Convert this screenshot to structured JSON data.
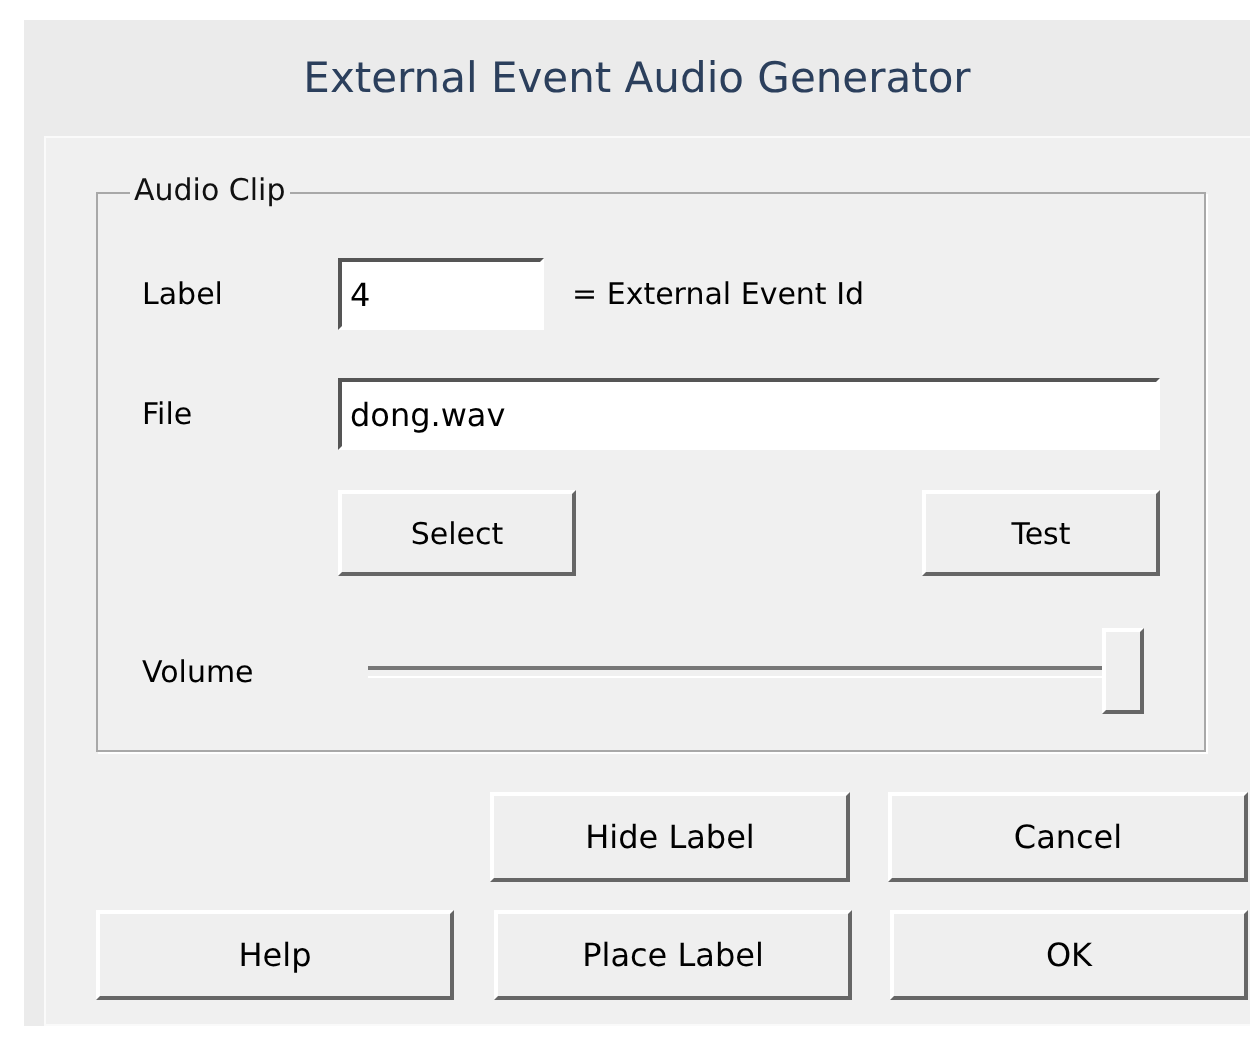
{
  "window": {
    "title": "External Event Audio Generator"
  },
  "group": {
    "title": "Audio Clip"
  },
  "label_field": {
    "label": "Label",
    "value": "4",
    "note": "= External Event Id"
  },
  "file_field": {
    "label": "File",
    "value": "dong.wav"
  },
  "clip_buttons": [
    "Select",
    "Test"
  ],
  "volume": {
    "label": "Volume",
    "level": 1.0
  },
  "button_rows": [
    [
      "Hide Label",
      "Cancel"
    ],
    [
      "Help",
      "Place Label",
      "OK"
    ]
  ]
}
